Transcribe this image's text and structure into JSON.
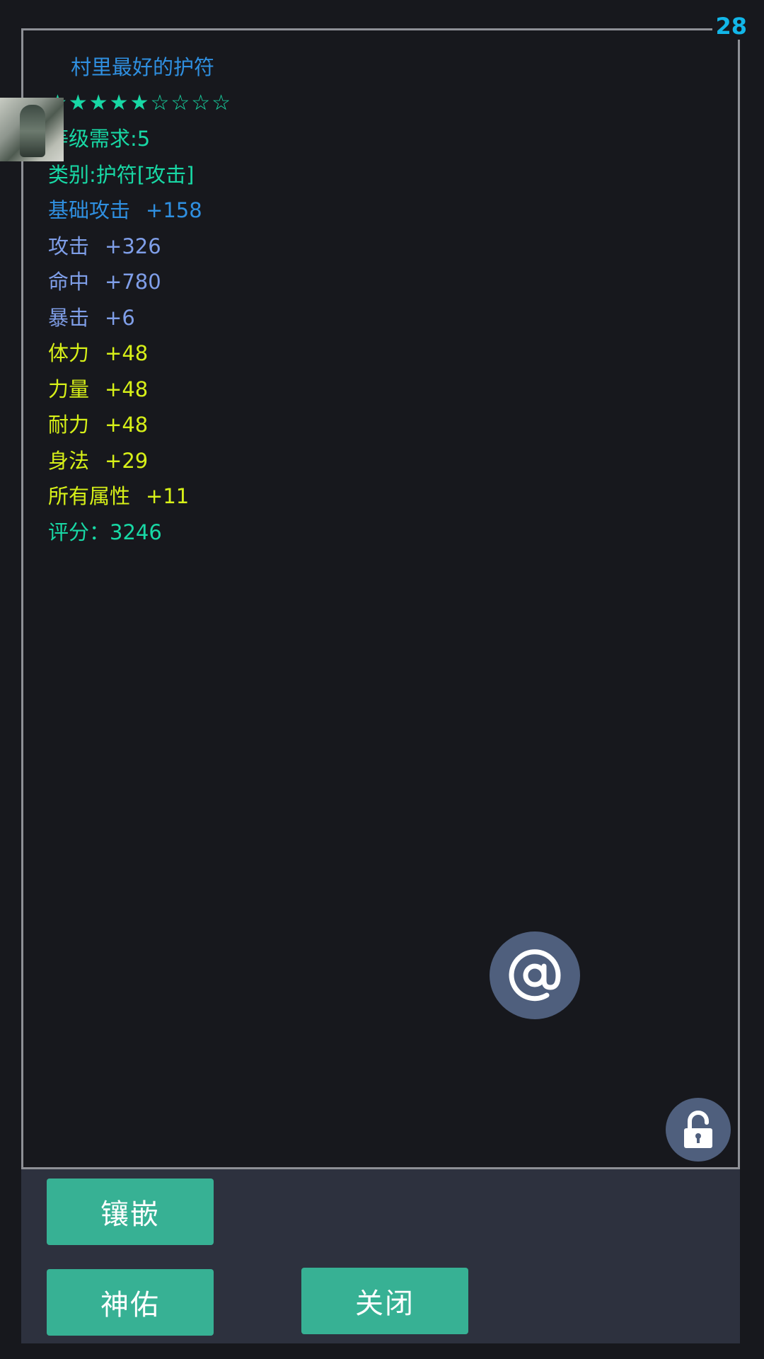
{
  "counter": "28",
  "item": {
    "name": "村里最好的护符",
    "stars": "★★★★★☆☆☆☆",
    "level_req": "等级需求:5",
    "category": "类别:护符[攻击]",
    "base_attack": {
      "label": "基础攻击",
      "value": "+158"
    },
    "stats": [
      {
        "label": "攻击",
        "value": "+326",
        "color": "#7f9ee8"
      },
      {
        "label": "命中",
        "value": "+780",
        "color": "#7f9ee8"
      },
      {
        "label": "暴击",
        "value": "+6",
        "color": "#7f9ee8"
      },
      {
        "label": "体力",
        "value": "+48",
        "color": "#d7f018"
      },
      {
        "label": "力量",
        "value": "+48",
        "color": "#d7f018"
      },
      {
        "label": "耐力",
        "value": "+48",
        "color": "#d7f018"
      },
      {
        "label": "身法",
        "value": "+29",
        "color": "#d7f018"
      },
      {
        "label": "所有属性",
        "value": "+11",
        "color": "#d7f018"
      }
    ],
    "score": "评分：3246"
  },
  "icons": {
    "mention": "at-icon",
    "lock": "unlock-icon",
    "thumbnail": "item-thumbnail"
  },
  "buttons": {
    "inlay": "镶嵌",
    "bless": "神佑",
    "close": "关闭"
  },
  "colors": {
    "background": "#17181d",
    "title": "#2f8fe0",
    "green": "#18d8a5",
    "lavender": "#7f9ee8",
    "yellow": "#d7f018",
    "button": "#37b194",
    "round_button": "#4f5f7d",
    "counter": "#12b6e8"
  }
}
